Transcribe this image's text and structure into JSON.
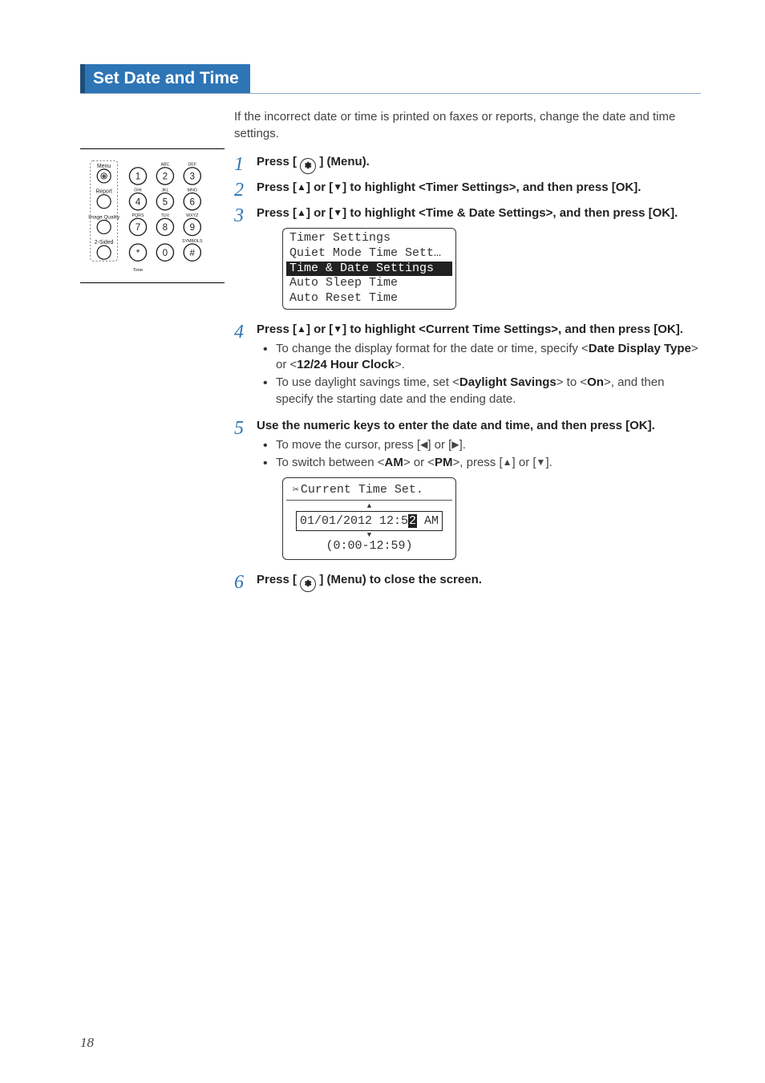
{
  "title": "Set Date and Time",
  "intro": "If the incorrect date or time is printed on faxes or reports, change the date and time settings.",
  "page_number": "18",
  "keypad": {
    "row_labels": [
      "Menu",
      "Report",
      "Image Quality",
      "2-Sided"
    ],
    "tone_label": "Tone",
    "keys": [
      {
        "n": "1",
        "sup": ""
      },
      {
        "n": "2",
        "sup": "ABC"
      },
      {
        "n": "3",
        "sup": "DEF"
      },
      {
        "n": "4",
        "sup": "GHI"
      },
      {
        "n": "5",
        "sup": "JKL"
      },
      {
        "n": "6",
        "sup": "MNO"
      },
      {
        "n": "7",
        "sup": "PQRS"
      },
      {
        "n": "8",
        "sup": "TUV"
      },
      {
        "n": "9",
        "sup": "WXYZ"
      },
      {
        "n": "*",
        "sup": ""
      },
      {
        "n": "0",
        "sup": ""
      },
      {
        "n": "#",
        "sup": "SYMBOLS"
      }
    ]
  },
  "steps": {
    "s1": {
      "pre": "Press [ ",
      "post": " ] (Menu)."
    },
    "s2": {
      "pre": "Press [",
      "mid": "] or [",
      "post": "] to highlight <Timer Settings>, and then press [OK]."
    },
    "s3": {
      "pre": "Press [",
      "mid": "] or [",
      "post": "] to highlight <Time & Date Settings>, and then press [OK]."
    },
    "s4": {
      "pre": "Press [",
      "mid": "] or [",
      "post": "] to highlight <Current Time Settings>, and then press [OK].",
      "b1a": "To change the display format for the date or time, specify <",
      "b1b": "Date Display Type",
      "b1c": "> or <",
      "b1d": "12/24 Hour Clock",
      "b1e": ">.",
      "b2a": "To use daylight savings time, set <",
      "b2b": "Daylight Savings",
      "b2c": "> to <",
      "b2d": "On",
      "b2e": ">, and then specify the starting date and the ending date."
    },
    "s5": {
      "head": "Use the numeric keys to enter the date and time, and then press [OK].",
      "b1a": "To move the cursor, press [",
      "b1b": "] or [",
      "b1c": "].",
      "b2a": "To switch between <",
      "b2b": "AM",
      "b2c": "> or <",
      "b2d": "PM",
      "b2e": ">, press [",
      "b2f": "] or [",
      "b2g": "]."
    },
    "s6": {
      "pre": "Press [ ",
      "post": " ] (Menu) to close the screen."
    }
  },
  "screen1": {
    "r1": "Timer Settings",
    "r2": " Quiet Mode Time Sett…",
    "r3": " Time & Date Settings",
    "r4": " Auto Sleep Time",
    "r5": " Auto Reset Time"
  },
  "screen2": {
    "hdr": "Current Time Set.",
    "date_a": "01/01/2012 12:5",
    "date_b": "2",
    "date_c": " AM",
    "range": "(0:00-12:59)"
  }
}
